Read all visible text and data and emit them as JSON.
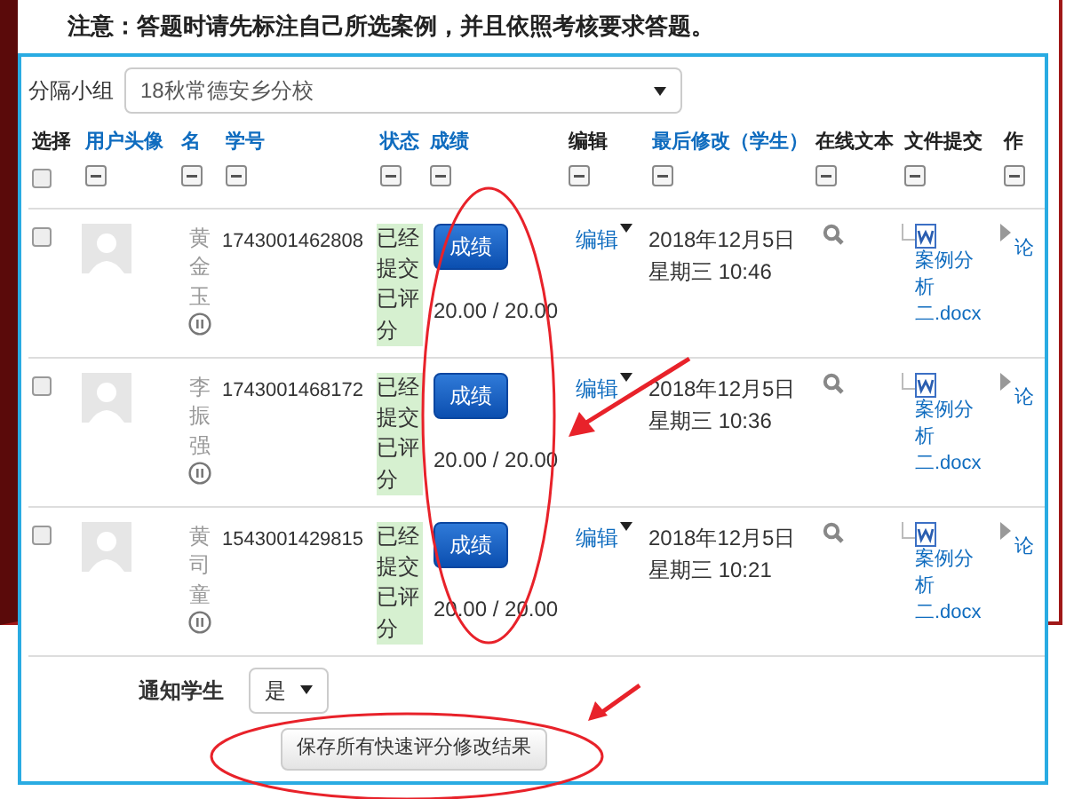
{
  "notice": "注意：答题时请先标注自己所选案例，并且依照考核要求答题。",
  "group_selector": {
    "label": "分隔小组",
    "value": "18秋常德安乡分校"
  },
  "columns": [
    {
      "label": "选择",
      "kind": "select",
      "checked": false
    },
    {
      "label": "用户头像",
      "kind": "link"
    },
    {
      "label": "名",
      "kind": "link"
    },
    {
      "label": "学号",
      "kind": "link"
    },
    {
      "label": "状态",
      "kind": "link"
    },
    {
      "label": "成绩",
      "kind": "link"
    },
    {
      "label": "编辑",
      "kind": "plain"
    },
    {
      "label": "最后修改（学生）",
      "kind": "link"
    },
    {
      "label": "在线文本",
      "kind": "plain"
    },
    {
      "label": "文件提交",
      "kind": "plain"
    },
    {
      "label": "作",
      "kind": "plain"
    }
  ],
  "rows": [
    {
      "selected": false,
      "name": "黄金玉",
      "id": "1743001462808",
      "status": "已经提交已评分",
      "grade_button": "成绩",
      "grade": "20.00 / 20.00",
      "edit": "编辑",
      "modified_date": "2018年12月5日",
      "modified_time": "星期三 10:46",
      "file_name": "案例分析二.docx",
      "column_11": "论"
    },
    {
      "selected": false,
      "name": "李振强",
      "id": "1743001468172",
      "status": "已经提交已评分",
      "grade_button": "成绩",
      "grade": "20.00 / 20.00",
      "edit": "编辑",
      "modified_date": "2018年12月5日",
      "modified_time": "星期三 10:36",
      "file_name": "案例分析二.docx",
      "column_11": "论"
    },
    {
      "selected": false,
      "name": "黄司童",
      "id": "1543001429815",
      "status": "已经提交已评分",
      "grade_button": "成绩",
      "grade": "20.00 / 20.00",
      "edit": "编辑",
      "modified_date": "2018年12月5日",
      "modified_time": "星期三 10:21",
      "file_name": "案例分析二.docx",
      "column_11": "论"
    }
  ],
  "notify": {
    "label": "通知学生",
    "value": "是"
  },
  "save_button": "保存所有快速评分修改结果"
}
